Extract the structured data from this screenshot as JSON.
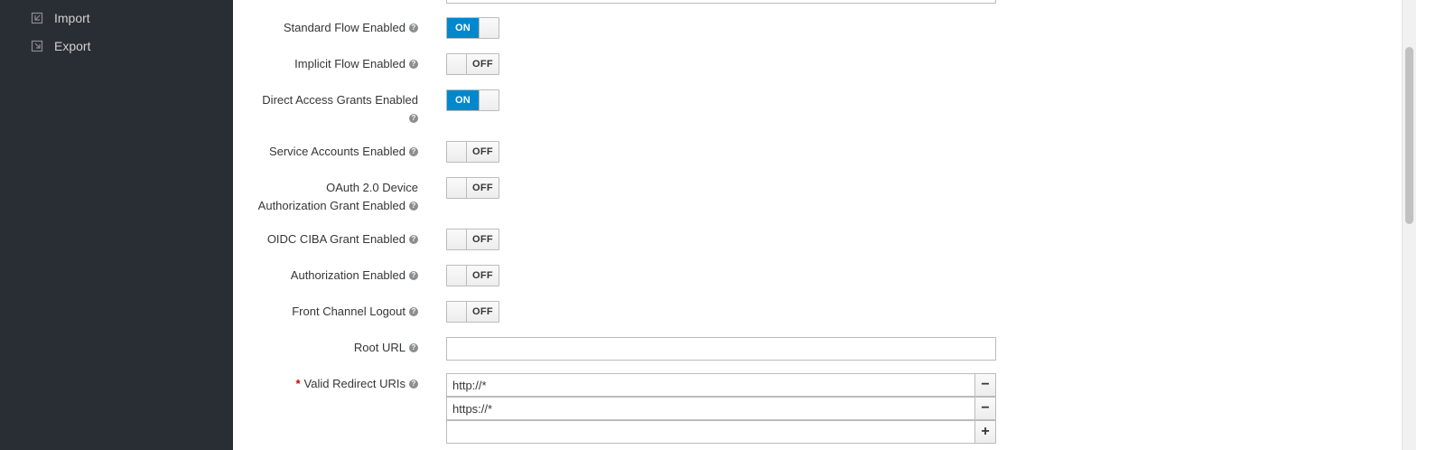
{
  "sidebar": {
    "items": [
      {
        "label": "Import",
        "icon": "import-icon"
      },
      {
        "label": "Export",
        "icon": "export-icon"
      }
    ]
  },
  "form": {
    "standard_flow": {
      "label": "Standard Flow Enabled",
      "state": "ON"
    },
    "implicit_flow": {
      "label": "Implicit Flow Enabled",
      "state": "OFF"
    },
    "direct_access": {
      "label": "Direct Access Grants Enabled",
      "state": "ON"
    },
    "service_accounts": {
      "label": "Service Accounts Enabled",
      "state": "OFF"
    },
    "device_grant": {
      "label_line1": "OAuth 2.0 Device",
      "label_line2": "Authorization Grant Enabled",
      "state": "OFF"
    },
    "ciba_grant": {
      "label": "OIDC CIBA Grant Enabled",
      "state": "OFF"
    },
    "authorization": {
      "label": "Authorization Enabled",
      "state": "OFF"
    },
    "front_channel_logout": {
      "label": "Front Channel Logout",
      "state": "OFF"
    },
    "root_url": {
      "label": "Root URL",
      "value": ""
    },
    "redirect_uris": {
      "required_mark": "*",
      "label": "Valid Redirect URIs",
      "values": [
        "http://*",
        "https://*",
        ""
      ],
      "remove_symbol": "−",
      "add_symbol": "+"
    }
  },
  "help_symbol": "?",
  "colors": {
    "sidebar_bg": "#292e34",
    "toggle_on": "#0088ce",
    "required": "#cc0000"
  }
}
